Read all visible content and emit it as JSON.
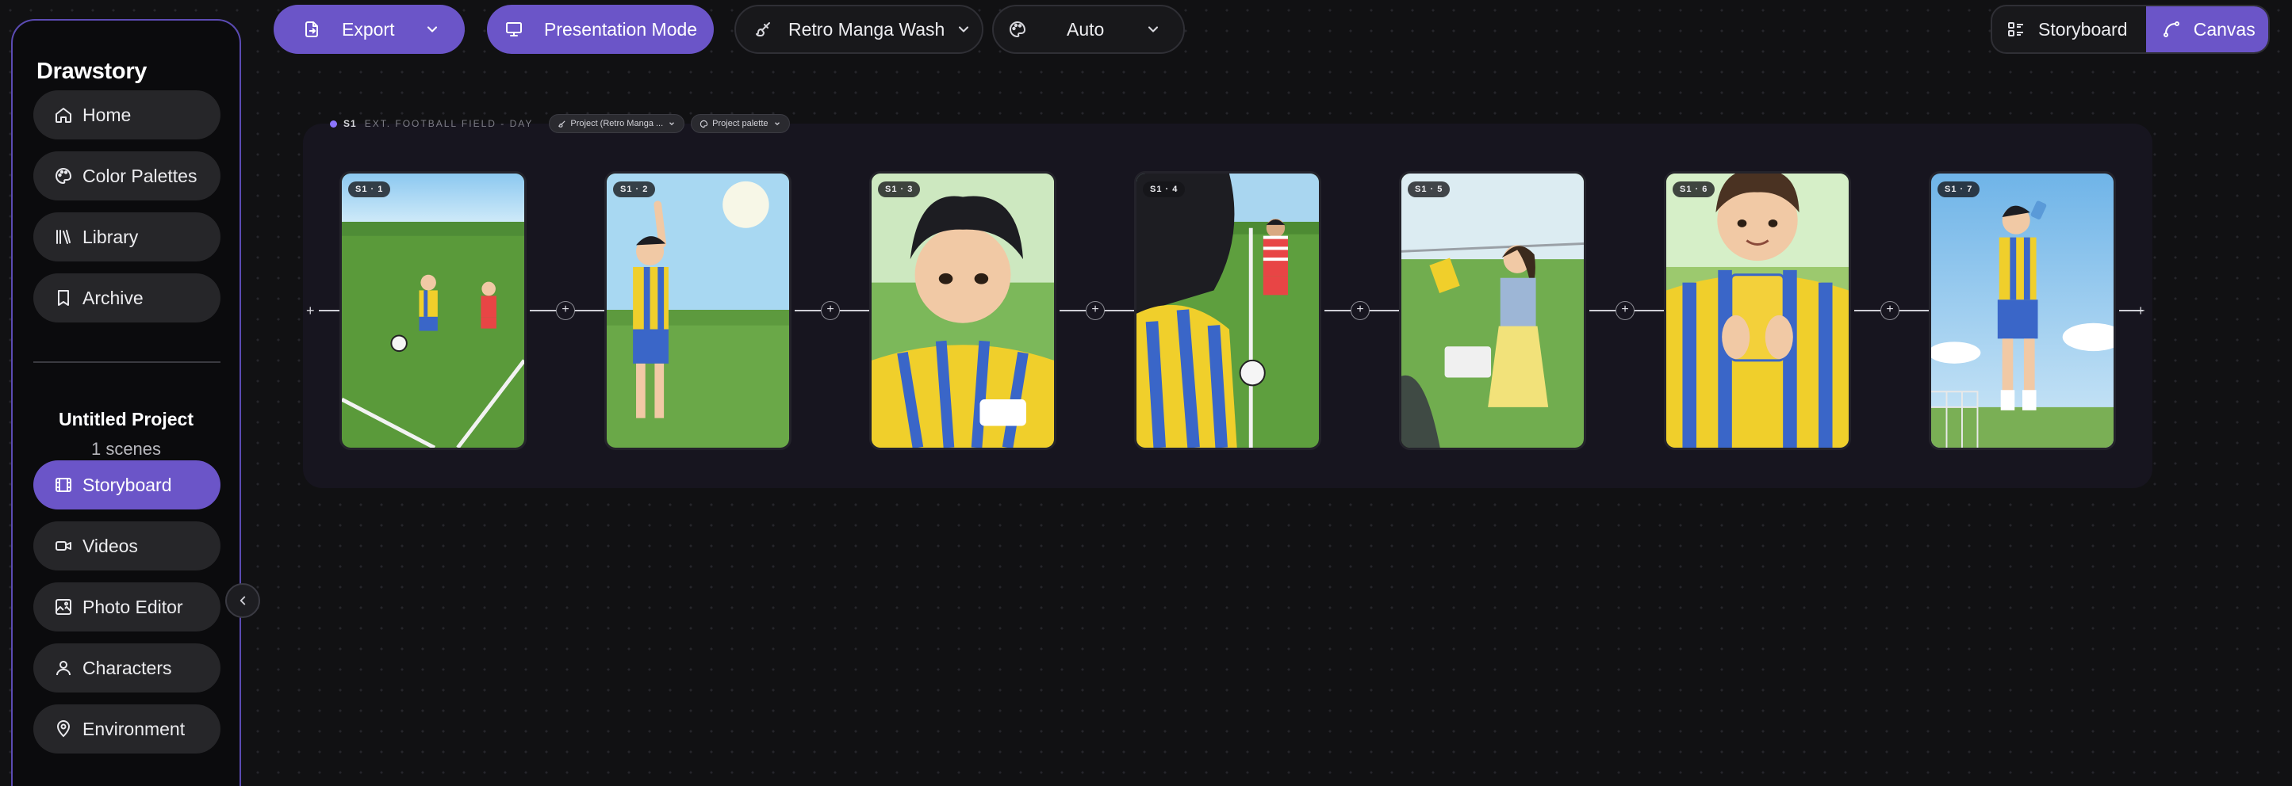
{
  "app": {
    "name": "Drawstory"
  },
  "sidebar": {
    "top_items": [
      {
        "label": "Home",
        "icon": "home-icon"
      },
      {
        "label": "Color Palettes",
        "icon": "palette-icon"
      },
      {
        "label": "Library",
        "icon": "library-icon"
      },
      {
        "label": "Archive",
        "icon": "bookmark-icon"
      }
    ],
    "project": {
      "title": "Untitled Project",
      "scenes": "1 scenes"
    },
    "project_items": [
      {
        "label": "Storyboard",
        "icon": "film-icon",
        "active": true
      },
      {
        "label": "Videos",
        "icon": "video-icon"
      },
      {
        "label": "Photo Editor",
        "icon": "photo-edit-icon"
      },
      {
        "label": "Characters",
        "icon": "user-icon"
      },
      {
        "label": "Environment",
        "icon": "location-pin-icon"
      }
    ]
  },
  "toolbar": {
    "export_label": "Export",
    "presentation_label": "Presentation Mode",
    "style_label": "Retro Manga Wash",
    "palette_label": "Auto",
    "view_storyboard": "Storyboard",
    "view_canvas": "Canvas"
  },
  "scene": {
    "id": "S1",
    "heading": "EXT. FOOTBALL FIELD - DAY",
    "style_chip": "Project (Retro Manga ...",
    "palette_chip": "Project palette"
  },
  "frames": [
    {
      "label": "S1 · 1"
    },
    {
      "label": "S1 · 2"
    },
    {
      "label": "S1 · 3"
    },
    {
      "label": "S1 · 4"
    },
    {
      "label": "S1 · 5"
    },
    {
      "label": "S1 · 6"
    },
    {
      "label": "S1 · 7"
    }
  ],
  "colors": {
    "accent": "#6b55c8",
    "accent_border": "#5b4bb3",
    "background": "#111113",
    "lane": "#17151f"
  }
}
